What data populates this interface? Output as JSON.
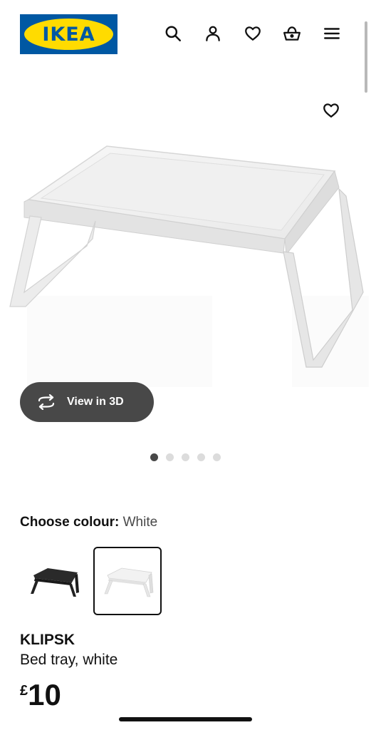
{
  "header": {
    "logo_text": "IKEA",
    "icons": [
      "search-icon",
      "user-icon",
      "heart-icon",
      "basket-icon",
      "menu-icon"
    ]
  },
  "product": {
    "favourite_icon": "heart-icon",
    "view_3d_label": "View in 3D",
    "gallery": {
      "total": 5,
      "active_index": 0
    },
    "colour_label": "Choose colour:",
    "colour_value": "White",
    "swatches": [
      {
        "name": "black",
        "color": "#2a2a2a",
        "selected": false
      },
      {
        "name": "white",
        "color": "#f2f2f2",
        "selected": true
      }
    ],
    "name": "KLIPSK",
    "description": "Bed tray, white",
    "price_currency": "£",
    "price_value": "10"
  },
  "colors": {
    "ikea_blue": "#0058a3",
    "ikea_yellow": "#ffdb00",
    "button_dark": "#484848"
  }
}
